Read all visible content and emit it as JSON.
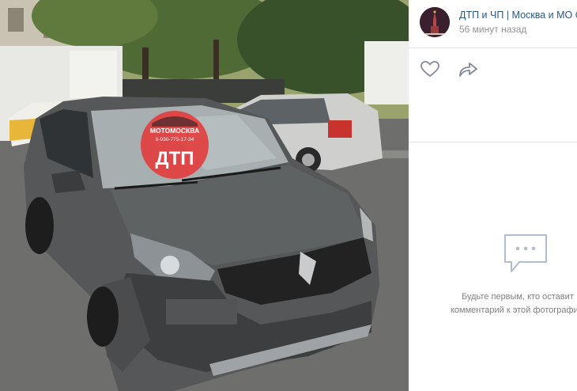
{
  "post": {
    "group_name": "ДТП и ЧП | Москва и МО Онлайн",
    "time": "56 минут назад",
    "like_icon": "heart-icon",
    "share_icon": "share-arrow-icon"
  },
  "photo": {
    "watermark_top": "МОТОМОСКВА",
    "watermark_phone": "8-930-775-17-34",
    "watermark_main": "ДТП"
  },
  "comments": {
    "empty_icon": "comment-bubble-icon",
    "empty_line1": "Будьте первым, кто оставит",
    "empty_line2": "комментарий к этой фотографии"
  },
  "colors": {
    "link": "#2a5885",
    "muted": "#939393",
    "watermark_red": "#e23c3c",
    "icon_gray": "#828a99"
  }
}
